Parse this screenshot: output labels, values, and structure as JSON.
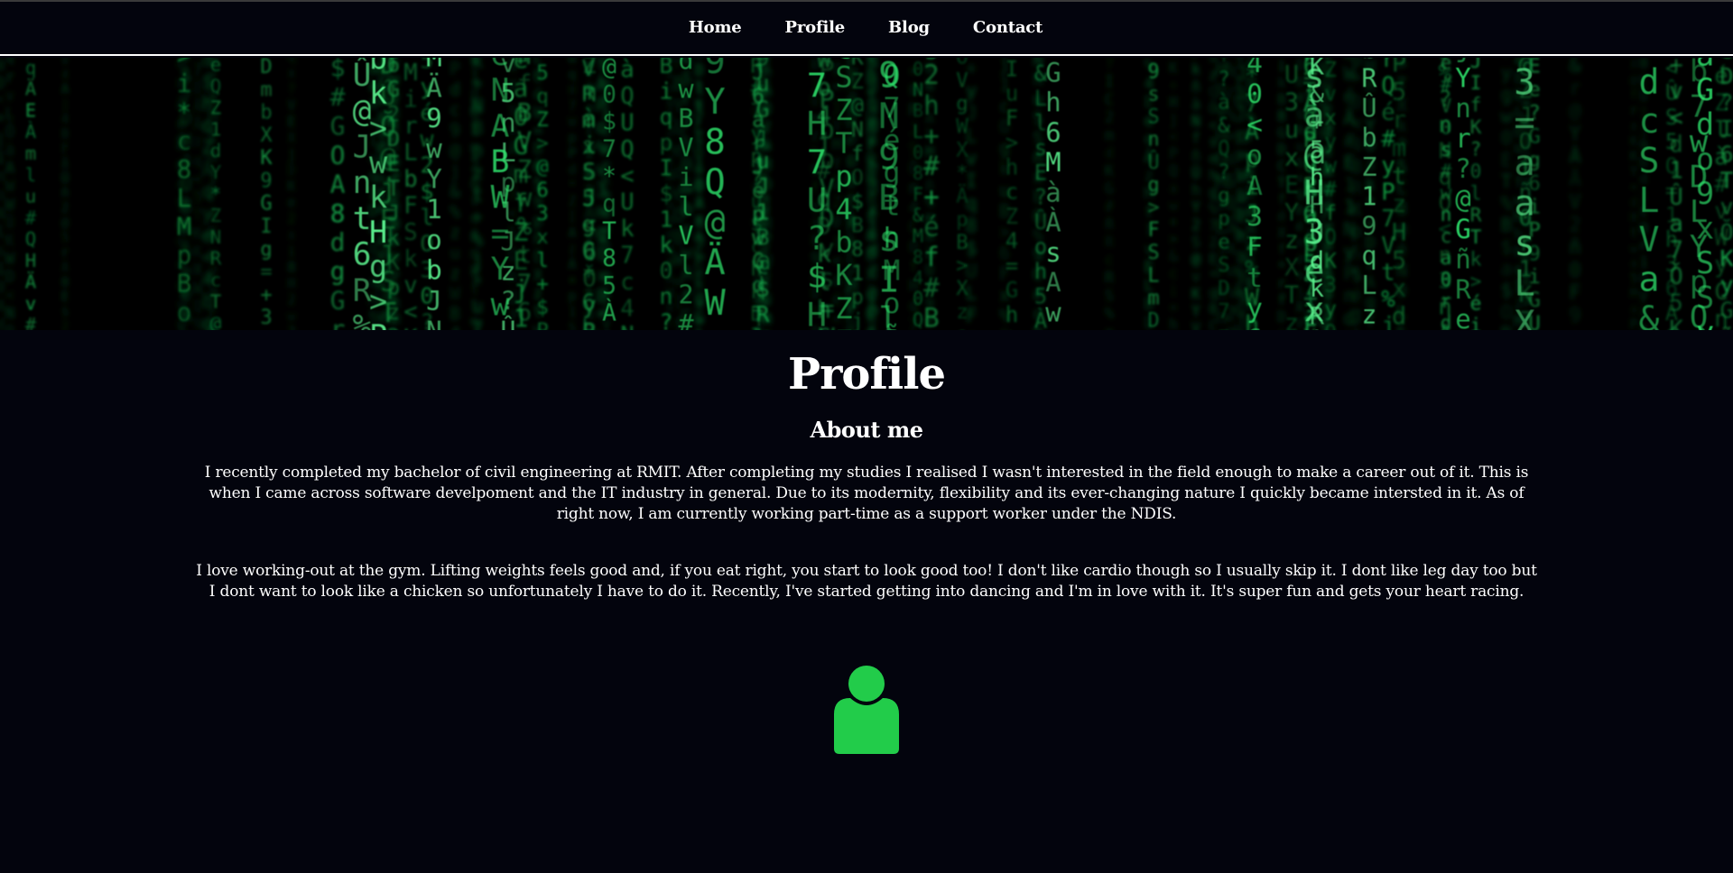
{
  "nav": {
    "items": [
      {
        "label": "Home"
      },
      {
        "label": "Profile"
      },
      {
        "label": "Blog"
      },
      {
        "label": "Contact"
      }
    ]
  },
  "banner": {
    "theme": "green matrix code rain",
    "accent": "#22cc55"
  },
  "main": {
    "title": "Profile",
    "heading": "About me",
    "paragraphs": [
      "I recently completed my bachelor of civil engineering at RMIT. After completing my studies I realised I wasn't interested in the field enough to make a career out of it. This is when I came across software develpoment and the IT industry in general. Due to its modernity, flexibility and its ever-changing nature I quickly became intersted in it. As of right now, I am currently working part-time as a support worker under the NDIS.",
      "I love working-out at the gym. Lifting weights feels good and, if you eat right, you start to look good too! I don't like cardio though so I usually skip it. I dont like leg day too but I dont want to look like a chicken so unfortunately I have to do it. Recently, I've started getting into dancing and I'm in love with it. It's super fun and gets your heart racing."
    ],
    "avatar_icon": "user-icon",
    "avatar_color": "#22cc4a"
  },
  "colors": {
    "background": "#03040d",
    "text": "#ffffff",
    "divider": "#ffffff"
  }
}
